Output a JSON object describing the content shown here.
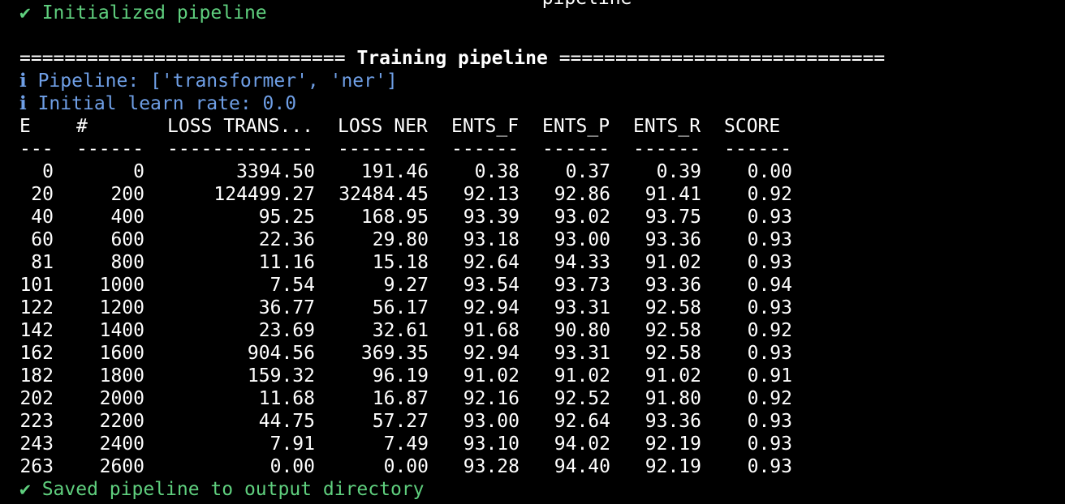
{
  "terminal": {
    "top_fragment": "  pipeline  ",
    "initialized": "✔ Initialized pipeline",
    "training_rule_left": "=============================",
    "training_title": "Training pipeline",
    "training_rule_right": "=============================",
    "pipeline_info": "ℹ Pipeline: ['transformer', 'ner']",
    "learn_rate_info": "ℹ Initial learn rate: 0.0",
    "saved": "✔ Saved pipeline to output directory",
    "colors": {
      "success": "#5fcf7e",
      "info": "#6f9fe6",
      "text": "#ffffff",
      "background": "#000000"
    }
  },
  "table": {
    "headers": [
      "E",
      "#",
      "LOSS TRANS...",
      "LOSS NER",
      "ENTS_F",
      "ENTS_P",
      "ENTS_R",
      "SCORE"
    ],
    "separators": [
      "---",
      "------",
      "-------------",
      "--------",
      "------",
      "------",
      "------",
      "------"
    ],
    "rows": [
      [
        "0",
        "0",
        "3394.50",
        "191.46",
        "0.38",
        "0.37",
        "0.39",
        "0.00"
      ],
      [
        "20",
        "200",
        "124499.27",
        "32484.45",
        "92.13",
        "92.86",
        "91.41",
        "0.92"
      ],
      [
        "40",
        "400",
        "95.25",
        "168.95",
        "93.39",
        "93.02",
        "93.75",
        "0.93"
      ],
      [
        "60",
        "600",
        "22.36",
        "29.80",
        "93.18",
        "93.00",
        "93.36",
        "0.93"
      ],
      [
        "81",
        "800",
        "11.16",
        "15.18",
        "92.64",
        "94.33",
        "91.02",
        "0.93"
      ],
      [
        "101",
        "1000",
        "7.54",
        "9.27",
        "93.54",
        "93.73",
        "93.36",
        "0.94"
      ],
      [
        "122",
        "1200",
        "36.77",
        "56.17",
        "92.94",
        "93.31",
        "92.58",
        "0.93"
      ],
      [
        "142",
        "1400",
        "23.69",
        "32.61",
        "91.68",
        "90.80",
        "92.58",
        "0.92"
      ],
      [
        "162",
        "1600",
        "904.56",
        "369.35",
        "92.94",
        "93.31",
        "92.58",
        "0.93"
      ],
      [
        "182",
        "1800",
        "159.32",
        "96.19",
        "91.02",
        "91.02",
        "91.02",
        "0.91"
      ],
      [
        "202",
        "2000",
        "11.68",
        "16.87",
        "92.16",
        "92.52",
        "91.80",
        "0.92"
      ],
      [
        "223",
        "2200",
        "44.75",
        "57.27",
        "93.00",
        "92.64",
        "93.36",
        "0.93"
      ],
      [
        "243",
        "2400",
        "7.91",
        "7.49",
        "93.10",
        "94.02",
        "92.19",
        "0.93"
      ],
      [
        "263",
        "2600",
        "0.00",
        "0.00",
        "93.28",
        "94.40",
        "92.19",
        "0.93"
      ]
    ]
  }
}
